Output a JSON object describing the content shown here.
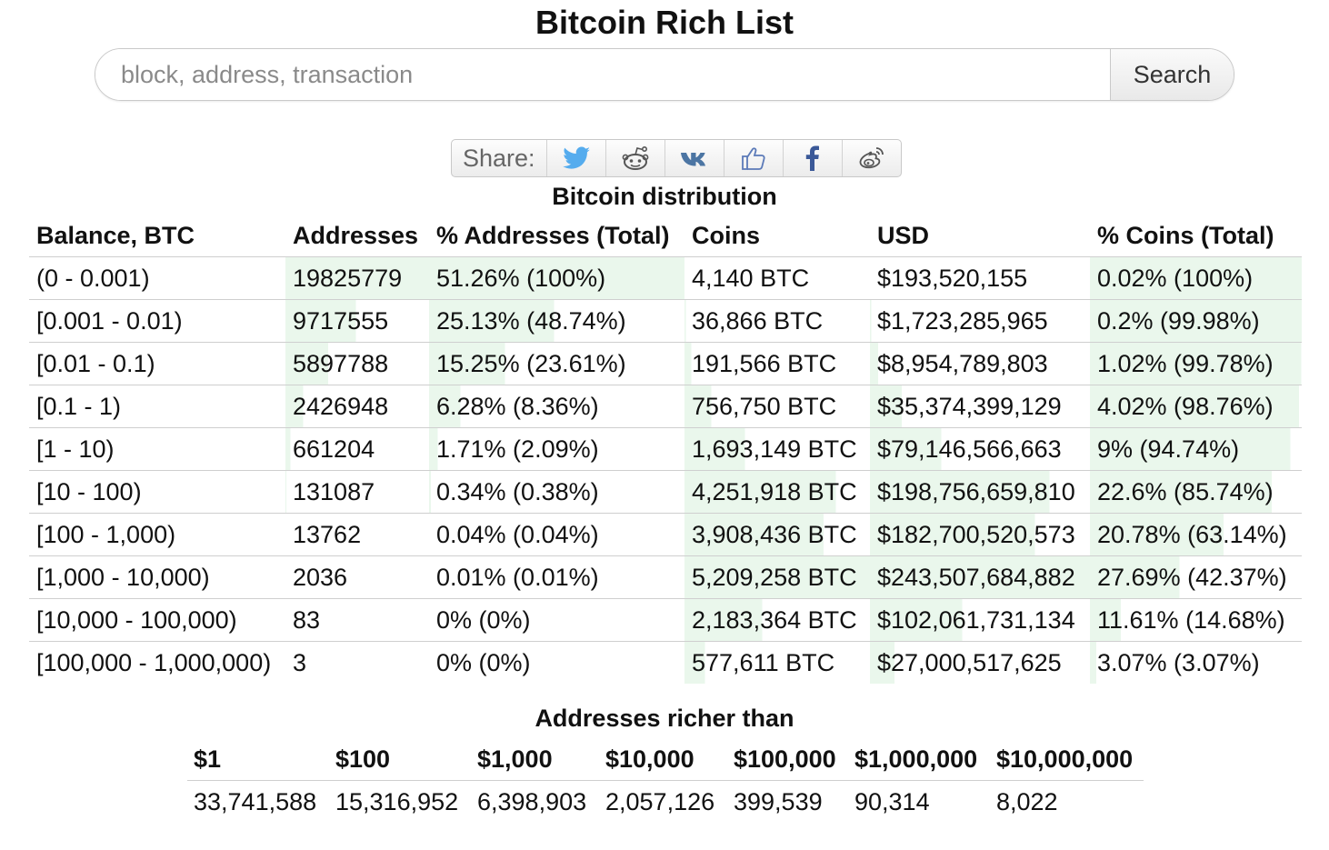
{
  "page": {
    "title": "Bitcoin Rich List"
  },
  "search": {
    "placeholder": "block, address, transaction",
    "value": "",
    "button_label": "Search"
  },
  "share": {
    "label": "Share:",
    "icons": [
      "twitter-icon",
      "reddit-icon",
      "vk-icon",
      "like-icon",
      "facebook-icon",
      "weibo-icon"
    ]
  },
  "colors": {
    "bar_fill": "#eaf7ec",
    "border": "#cfcfcf",
    "twitter": "#55acee",
    "facebook": "#3b5998",
    "vk": "#4c75a3"
  },
  "distribution": {
    "caption": "Bitcoin distribution",
    "headers": [
      "Balance, BTC",
      "Addresses",
      "% Addresses (Total)",
      "Coins",
      "USD",
      "% Coins (Total)"
    ],
    "rows": [
      {
        "balance": "(0 - 0.001)",
        "addresses": "19825779",
        "pct_addresses": "51.26% (100%)",
        "coins": "4,140 BTC",
        "usd": "$193,520,155",
        "pct_coins": "0.02% (100%)"
      },
      {
        "balance": "[0.001 - 0.01)",
        "addresses": "9717555",
        "pct_addresses": "25.13% (48.74%)",
        "coins": "36,866 BTC",
        "usd": "$1,723,285,965",
        "pct_coins": "0.2% (99.98%)"
      },
      {
        "balance": "[0.01 - 0.1)",
        "addresses": "5897788",
        "pct_addresses": "15.25% (23.61%)",
        "coins": "191,566 BTC",
        "usd": "$8,954,789,803",
        "pct_coins": "1.02% (99.78%)"
      },
      {
        "balance": "[0.1 - 1)",
        "addresses": "2426948",
        "pct_addresses": "6.28% (8.36%)",
        "coins": "756,750 BTC",
        "usd": "$35,374,399,129",
        "pct_coins": "4.02% (98.76%)"
      },
      {
        "balance": "[1 - 10)",
        "addresses": "661204",
        "pct_addresses": "1.71% (2.09%)",
        "coins": "1,693,149 BTC",
        "usd": "$79,146,566,663",
        "pct_coins": "9% (94.74%)"
      },
      {
        "balance": "[10 - 100)",
        "addresses": "131087",
        "pct_addresses": "0.34% (0.38%)",
        "coins": "4,251,918 BTC",
        "usd": "$198,756,659,810",
        "pct_coins": "22.6% (85.74%)"
      },
      {
        "balance": "[100 - 1,000)",
        "addresses": "13762",
        "pct_addresses": "0.04% (0.04%)",
        "coins": "3,908,436 BTC",
        "usd": "$182,700,520,573",
        "pct_coins": "20.78% (63.14%)"
      },
      {
        "balance": "[1,000 - 10,000)",
        "addresses": "2036",
        "pct_addresses": "0.01% (0.01%)",
        "coins": "5,209,258 BTC",
        "usd": "$243,507,684,882",
        "pct_coins": "27.69% (42.37%)"
      },
      {
        "balance": "[10,000 - 100,000)",
        "addresses": "83",
        "pct_addresses": "0% (0%)",
        "coins": "2,183,364 BTC",
        "usd": "$102,061,731,134",
        "pct_coins": "11.61% (14.68%)"
      },
      {
        "balance": "[100,000 - 1,000,000)",
        "addresses": "3",
        "pct_addresses": "0% (0%)",
        "coins": "577,611 BTC",
        "usd": "$27,000,517,625",
        "pct_coins": "3.07% (3.07%)"
      }
    ]
  },
  "richer_than": {
    "caption": "Addresses richer than",
    "headers": [
      "$1",
      "$100",
      "$1,000",
      "$10,000",
      "$100,000",
      "$1,000,000",
      "$10,000,000"
    ],
    "values": [
      "33,741,588",
      "15,316,952",
      "6,398,903",
      "2,057,126",
      "399,539",
      "90,314",
      "8,022"
    ]
  }
}
